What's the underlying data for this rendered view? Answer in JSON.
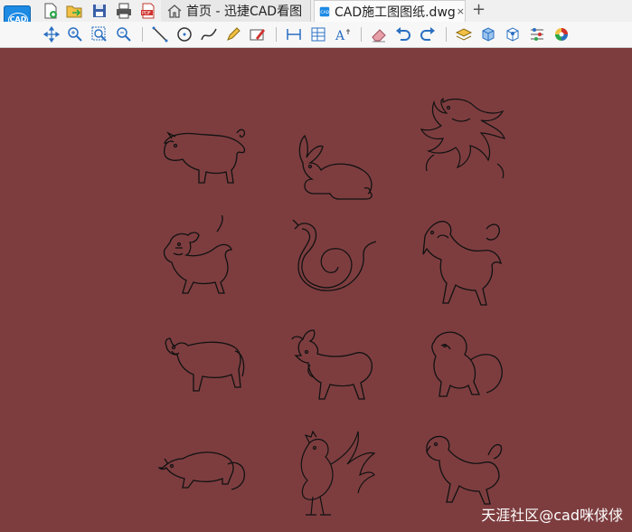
{
  "app": {
    "logo_text": "CAD"
  },
  "tabs": [
    {
      "label": "首页 - 迅捷CAD看图",
      "icon": "home-icon"
    },
    {
      "label": "CAD施工图图纸.dwg",
      "icon": "cad-file-icon",
      "close_glyph": "×"
    }
  ],
  "new_tab_glyph": "+",
  "quick_access": [
    "new-file-icon",
    "open-file-icon",
    "save-icon",
    "print-icon",
    "export-pdf-icon"
  ],
  "toolbar": [
    "pan-icon",
    "zoom-window-icon",
    "zoom-extents-icon",
    "zoom-realtime-icon",
    "line-icon",
    "circle-icon",
    "polyline-icon",
    "pen-icon",
    "mark-icon",
    "measure-icon",
    "table-icon",
    "text-icon",
    "eraser-icon",
    "undo-icon",
    "redo-icon",
    "layer-icon",
    "3d-box-icon",
    "3d-view-icon",
    "properties-icon",
    "color-wheel-icon"
  ],
  "drawing": {
    "background": "#7d3d3f",
    "animals": [
      "pig",
      "rabbit",
      "dragon",
      "tiger",
      "snake",
      "horse",
      "ox",
      "goat",
      "monkey",
      "rat",
      "rooster",
      "dog"
    ]
  },
  "watermark": "天涯社区@cad咪俅俅"
}
